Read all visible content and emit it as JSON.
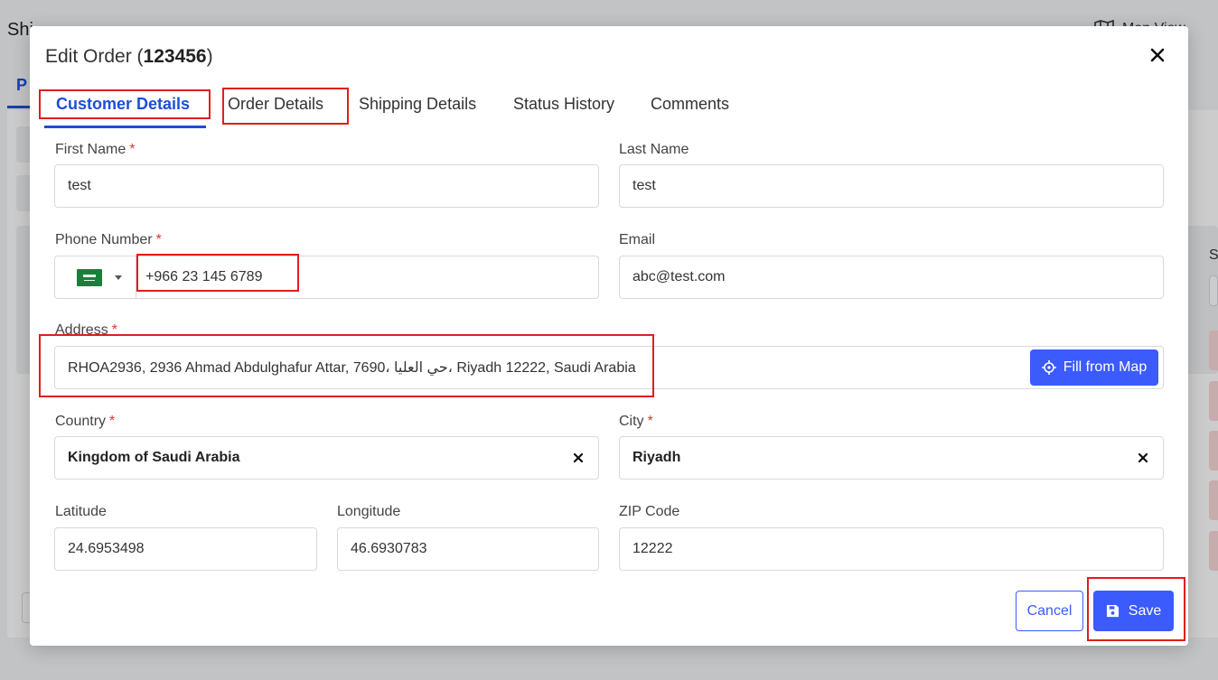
{
  "background": {
    "page_title": "Shi",
    "map_view_label": "Map View",
    "active_tab_label": "P",
    "side_label": "S"
  },
  "modal": {
    "title_prefix": "Edit Order (",
    "order_id": "123456",
    "title_suffix": ")",
    "tabs": [
      {
        "label": "Customer Details",
        "active": true
      },
      {
        "label": "Order Details",
        "active": false
      },
      {
        "label": "Shipping Details",
        "active": false
      },
      {
        "label": "Status History",
        "active": false
      },
      {
        "label": "Comments",
        "active": false
      }
    ],
    "required_mark": "*",
    "fields": {
      "first_name": {
        "label": "First Name",
        "value": "test",
        "required": true
      },
      "last_name": {
        "label": "Last Name",
        "value": "test",
        "required": false
      },
      "phone": {
        "label": "Phone Number",
        "value": "+966 23 145 6789",
        "required": true,
        "country_flag": "saudi-arabia-flag"
      },
      "email": {
        "label": "Email",
        "value": "abc@test.com",
        "required": false
      },
      "address": {
        "label": "Address",
        "value": "RHOA2936, 2936 Ahmad Abdulghafur Attar, 7690، حي العليا، Riyadh 12222, Saudi Arabia",
        "required": true
      },
      "country": {
        "label": "Country",
        "value": "Kingdom of Saudi Arabia",
        "required": true
      },
      "city": {
        "label": "City",
        "value": "Riyadh",
        "required": true
      },
      "latitude": {
        "label": "Latitude",
        "value": "24.6953498"
      },
      "longitude": {
        "label": "Longitude",
        "value": "46.6930783"
      },
      "zip": {
        "label": "ZIP Code",
        "value": "12222"
      }
    },
    "fill_from_map_label": "Fill from Map",
    "cancel_label": "Cancel",
    "save_label": "Save"
  },
  "colors": {
    "accent": "#3b5bfd",
    "tab_active": "#1d4ed8",
    "required": "#e3342f",
    "highlight": "#e11d1d"
  }
}
